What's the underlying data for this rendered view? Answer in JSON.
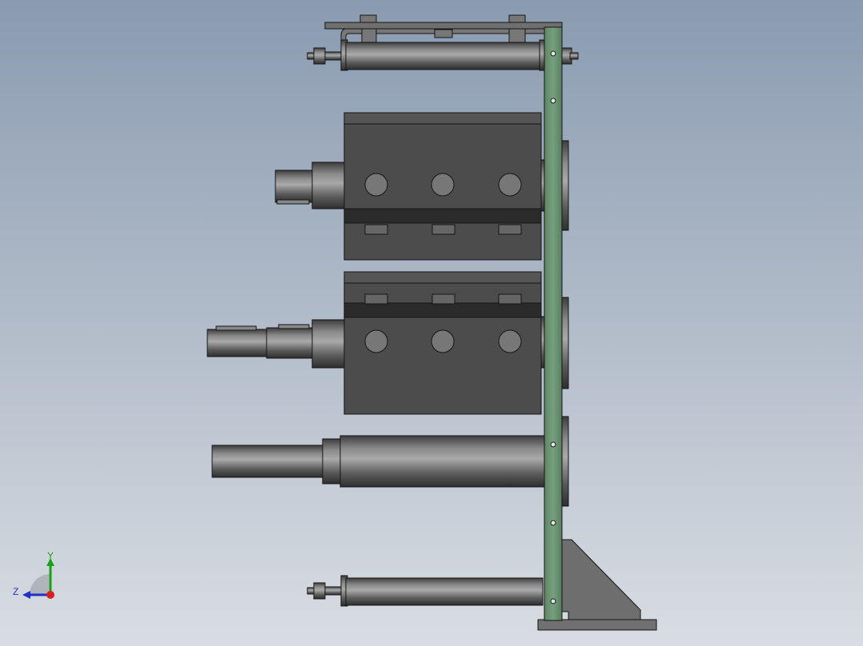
{
  "viewport": {
    "background_top": "#8a9bb0",
    "background_bottom": "#d9dde3"
  },
  "colors": {
    "green_plate": "#6a9072",
    "dark_body": "#4a4a4a",
    "steel": "#6a6a6a",
    "edge": "#1a1a1a"
  },
  "triad": {
    "y_label": "Y",
    "z_label": "Z",
    "x_color": "#d42020",
    "y_color": "#1ca01c",
    "z_color": "#2030c8"
  }
}
